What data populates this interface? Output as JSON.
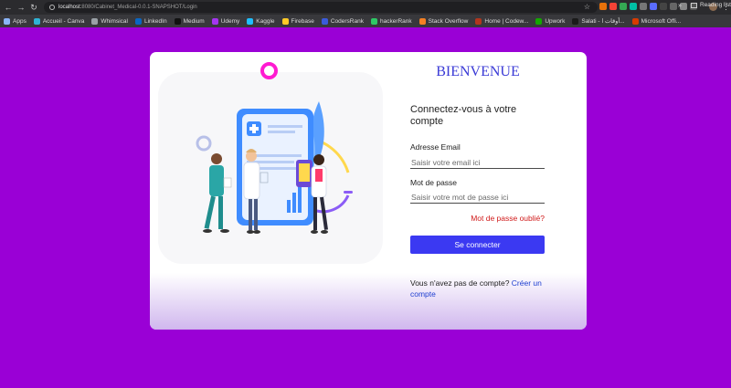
{
  "browser": {
    "url_host": "localhost:",
    "url_path": "8080/Cabinet_Medical-0.0.1-SNAPSHOT/Login",
    "reading_list": "Reading list",
    "bookmarks": [
      {
        "label": "Apps",
        "icon": "apps-grid-icon",
        "color": "#8ab4f8"
      },
      {
        "label": "Accueil - Canva",
        "icon": "canva-icon",
        "color": "#2fb3d6"
      },
      {
        "label": "Whimsical",
        "icon": "folder-icon",
        "color": "#9aa0a6"
      },
      {
        "label": "LinkedIn",
        "icon": "linkedin-icon",
        "color": "#0a66c2"
      },
      {
        "label": "Medium",
        "icon": "medium-icon",
        "color": "#111111"
      },
      {
        "label": "Udemy",
        "icon": "udemy-icon",
        "color": "#a435f0"
      },
      {
        "label": "Kaggle",
        "icon": "kaggle-icon",
        "color": "#20beff"
      },
      {
        "label": "Firebase",
        "icon": "firebase-icon",
        "color": "#ffca28"
      },
      {
        "label": "CodersRank",
        "icon": "codersrank-icon",
        "color": "#3b5bdb"
      },
      {
        "label": "hackerRank",
        "icon": "hackerrank-icon",
        "color": "#2ec866"
      },
      {
        "label": "Stack Overflow",
        "icon": "stackoverflow-icon",
        "color": "#f48024"
      },
      {
        "label": "Home | Codew...",
        "icon": "codewars-icon",
        "color": "#b1361e"
      },
      {
        "label": "Upwork",
        "icon": "upwork-icon",
        "color": "#14a800"
      },
      {
        "label": "Salati - أوقات ا...",
        "icon": "salati-icon",
        "color": "#1a1a1a"
      },
      {
        "label": "Microsoft Offi...",
        "icon": "office-icon",
        "color": "#d83b01"
      }
    ]
  },
  "login": {
    "welcome": "BIENVENUE",
    "subtitle": "Connectez-vous à votre compte",
    "email_label": "Adresse Email",
    "email_placeholder": "Saisir votre email ici",
    "password_label": "Mot de passe",
    "password_placeholder": "Saisir votre mot de passe ici",
    "forgot": "Mot de passe oublié?",
    "submit": "Se connecter",
    "no_account": "Vous n'avez pas de compte?",
    "create_account": "Créer un compte"
  },
  "colors": {
    "background": "#9a00d6",
    "accent": "#3b39f2",
    "error": "#d01a1a",
    "link": "#1e3fd0"
  }
}
